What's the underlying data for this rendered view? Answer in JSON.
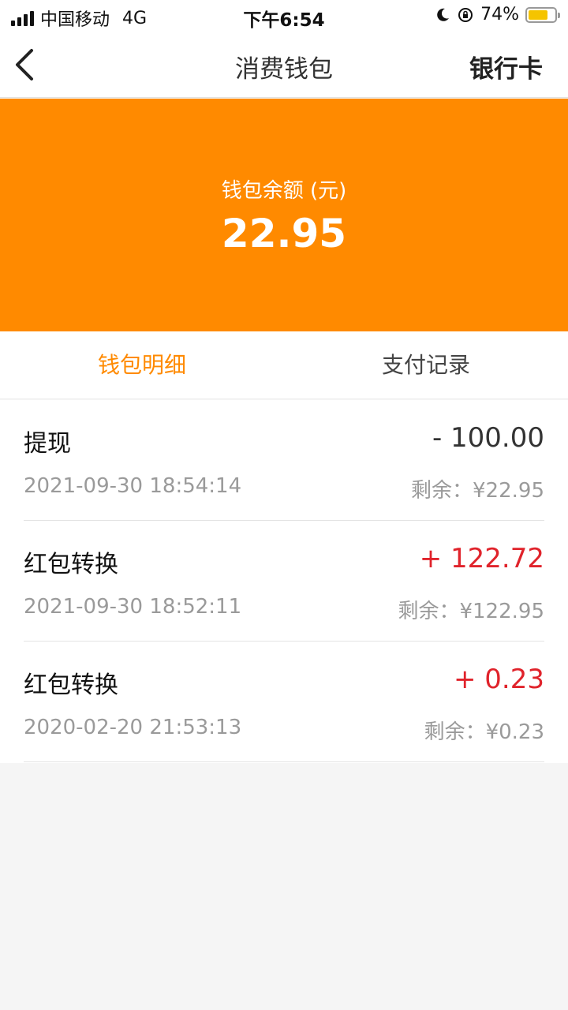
{
  "status_bar": {
    "carrier": "中国移动",
    "network": "4G",
    "time": "下午6:54",
    "battery_text": "74%",
    "battery_level": 0.74
  },
  "nav": {
    "title": "消费钱包",
    "right_label": "银行卡"
  },
  "balance": {
    "label": "钱包余额 (元)",
    "value": "22.95"
  },
  "tabs": [
    {
      "label": "钱包明细",
      "active": true
    },
    {
      "label": "支付记录",
      "active": false
    }
  ],
  "records": [
    {
      "title": "提现",
      "amount": "- 100.00",
      "type": "negative",
      "time": "2021-09-30 18:54:14",
      "remaining": "剩余：¥22.95"
    },
    {
      "title": "红包转换",
      "amount": "+ 122.72",
      "type": "positive",
      "time": "2021-09-30 18:52:11",
      "remaining": "剩余：¥122.95"
    },
    {
      "title": "红包转换",
      "amount": "+ 0.23",
      "type": "positive",
      "time": "2020-02-20 21:53:13",
      "remaining": "剩余：¥0.23"
    }
  ],
  "colors": {
    "accent": "#ff8a00",
    "positive": "#e0232b"
  }
}
